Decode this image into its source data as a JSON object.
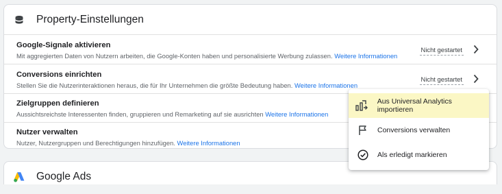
{
  "property_card": {
    "title": "Property-Einstellungen",
    "icon": "database-icon",
    "rows": [
      {
        "title": "Google-Signale aktivieren",
        "description": "Mit aggregierten Daten von Nutzern arbeiten, die Google-Konten haben und personalisierte Werbung zulassen.",
        "link": "Weitere Informationen",
        "status": "Nicht gestartet"
      },
      {
        "title": "Conversions einrichten",
        "description": "Stellen Sie die Nutzerinteraktionen heraus, die für Ihr Unternehmen die größte Bedeutung haben.",
        "link": "Weitere Informationen",
        "status": "Nicht gestartet"
      },
      {
        "title": "Zielgruppen definieren",
        "description": "Aussichtsreichste Interessenten finden, gruppieren und Remarketing auf sie ausrichten",
        "link": "Weitere Informationen"
      },
      {
        "title": "Nutzer verwalten",
        "description": "Nutzer, Nutzergruppen und Berechtigungen hinzufügen.",
        "link": "Weitere Informationen"
      }
    ]
  },
  "ads_card": {
    "title": "Google Ads",
    "icon": "google-ads-logo"
  },
  "menu": {
    "items": [
      {
        "label": "Aus Universal Analytics importieren",
        "icon": "import-icon",
        "selected": true
      },
      {
        "label": "Conversions verwalten",
        "icon": "flag-icon",
        "selected": false
      },
      {
        "label": "Als erledigt markieren",
        "icon": "check-circle-icon",
        "selected": false
      }
    ]
  },
  "colors": {
    "link": "#1a73e8",
    "highlight": "#fbf7c5",
    "ads_blue": "#4285f4",
    "ads_yellow": "#fbbc04",
    "ads_green": "#34a853"
  }
}
